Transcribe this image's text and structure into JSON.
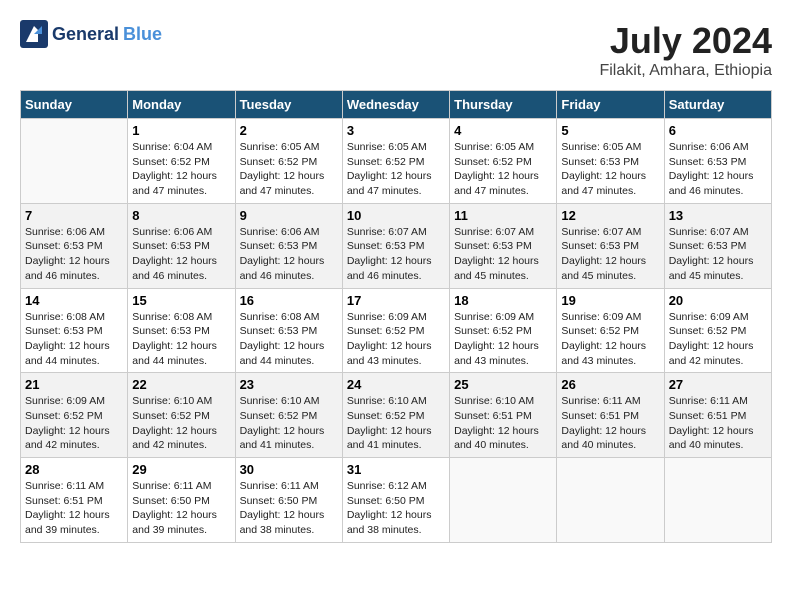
{
  "header": {
    "logo_general": "General",
    "logo_blue": "Blue",
    "month": "July 2024",
    "location": "Filakit, Amhara, Ethiopia"
  },
  "days_of_week": [
    "Sunday",
    "Monday",
    "Tuesday",
    "Wednesday",
    "Thursday",
    "Friday",
    "Saturday"
  ],
  "weeks": [
    [
      {
        "day": "",
        "info": ""
      },
      {
        "day": "1",
        "info": "Sunrise: 6:04 AM\nSunset: 6:52 PM\nDaylight: 12 hours\nand 47 minutes."
      },
      {
        "day": "2",
        "info": "Sunrise: 6:05 AM\nSunset: 6:52 PM\nDaylight: 12 hours\nand 47 minutes."
      },
      {
        "day": "3",
        "info": "Sunrise: 6:05 AM\nSunset: 6:52 PM\nDaylight: 12 hours\nand 47 minutes."
      },
      {
        "day": "4",
        "info": "Sunrise: 6:05 AM\nSunset: 6:52 PM\nDaylight: 12 hours\nand 47 minutes."
      },
      {
        "day": "5",
        "info": "Sunrise: 6:05 AM\nSunset: 6:53 PM\nDaylight: 12 hours\nand 47 minutes."
      },
      {
        "day": "6",
        "info": "Sunrise: 6:06 AM\nSunset: 6:53 PM\nDaylight: 12 hours\nand 46 minutes."
      }
    ],
    [
      {
        "day": "7",
        "info": "Sunrise: 6:06 AM\nSunset: 6:53 PM\nDaylight: 12 hours\nand 46 minutes."
      },
      {
        "day": "8",
        "info": "Sunrise: 6:06 AM\nSunset: 6:53 PM\nDaylight: 12 hours\nand 46 minutes."
      },
      {
        "day": "9",
        "info": "Sunrise: 6:06 AM\nSunset: 6:53 PM\nDaylight: 12 hours\nand 46 minutes."
      },
      {
        "day": "10",
        "info": "Sunrise: 6:07 AM\nSunset: 6:53 PM\nDaylight: 12 hours\nand 46 minutes."
      },
      {
        "day": "11",
        "info": "Sunrise: 6:07 AM\nSunset: 6:53 PM\nDaylight: 12 hours\nand 45 minutes."
      },
      {
        "day": "12",
        "info": "Sunrise: 6:07 AM\nSunset: 6:53 PM\nDaylight: 12 hours\nand 45 minutes."
      },
      {
        "day": "13",
        "info": "Sunrise: 6:07 AM\nSunset: 6:53 PM\nDaylight: 12 hours\nand 45 minutes."
      }
    ],
    [
      {
        "day": "14",
        "info": "Sunrise: 6:08 AM\nSunset: 6:53 PM\nDaylight: 12 hours\nand 44 minutes."
      },
      {
        "day": "15",
        "info": "Sunrise: 6:08 AM\nSunset: 6:53 PM\nDaylight: 12 hours\nand 44 minutes."
      },
      {
        "day": "16",
        "info": "Sunrise: 6:08 AM\nSunset: 6:53 PM\nDaylight: 12 hours\nand 44 minutes."
      },
      {
        "day": "17",
        "info": "Sunrise: 6:09 AM\nSunset: 6:52 PM\nDaylight: 12 hours\nand 43 minutes."
      },
      {
        "day": "18",
        "info": "Sunrise: 6:09 AM\nSunset: 6:52 PM\nDaylight: 12 hours\nand 43 minutes."
      },
      {
        "day": "19",
        "info": "Sunrise: 6:09 AM\nSunset: 6:52 PM\nDaylight: 12 hours\nand 43 minutes."
      },
      {
        "day": "20",
        "info": "Sunrise: 6:09 AM\nSunset: 6:52 PM\nDaylight: 12 hours\nand 42 minutes."
      }
    ],
    [
      {
        "day": "21",
        "info": "Sunrise: 6:09 AM\nSunset: 6:52 PM\nDaylight: 12 hours\nand 42 minutes."
      },
      {
        "day": "22",
        "info": "Sunrise: 6:10 AM\nSunset: 6:52 PM\nDaylight: 12 hours\nand 42 minutes."
      },
      {
        "day": "23",
        "info": "Sunrise: 6:10 AM\nSunset: 6:52 PM\nDaylight: 12 hours\nand 41 minutes."
      },
      {
        "day": "24",
        "info": "Sunrise: 6:10 AM\nSunset: 6:52 PM\nDaylight: 12 hours\nand 41 minutes."
      },
      {
        "day": "25",
        "info": "Sunrise: 6:10 AM\nSunset: 6:51 PM\nDaylight: 12 hours\nand 40 minutes."
      },
      {
        "day": "26",
        "info": "Sunrise: 6:11 AM\nSunset: 6:51 PM\nDaylight: 12 hours\nand 40 minutes."
      },
      {
        "day": "27",
        "info": "Sunrise: 6:11 AM\nSunset: 6:51 PM\nDaylight: 12 hours\nand 40 minutes."
      }
    ],
    [
      {
        "day": "28",
        "info": "Sunrise: 6:11 AM\nSunset: 6:51 PM\nDaylight: 12 hours\nand 39 minutes."
      },
      {
        "day": "29",
        "info": "Sunrise: 6:11 AM\nSunset: 6:50 PM\nDaylight: 12 hours\nand 39 minutes."
      },
      {
        "day": "30",
        "info": "Sunrise: 6:11 AM\nSunset: 6:50 PM\nDaylight: 12 hours\nand 38 minutes."
      },
      {
        "day": "31",
        "info": "Sunrise: 6:12 AM\nSunset: 6:50 PM\nDaylight: 12 hours\nand 38 minutes."
      },
      {
        "day": "",
        "info": ""
      },
      {
        "day": "",
        "info": ""
      },
      {
        "day": "",
        "info": ""
      }
    ]
  ]
}
